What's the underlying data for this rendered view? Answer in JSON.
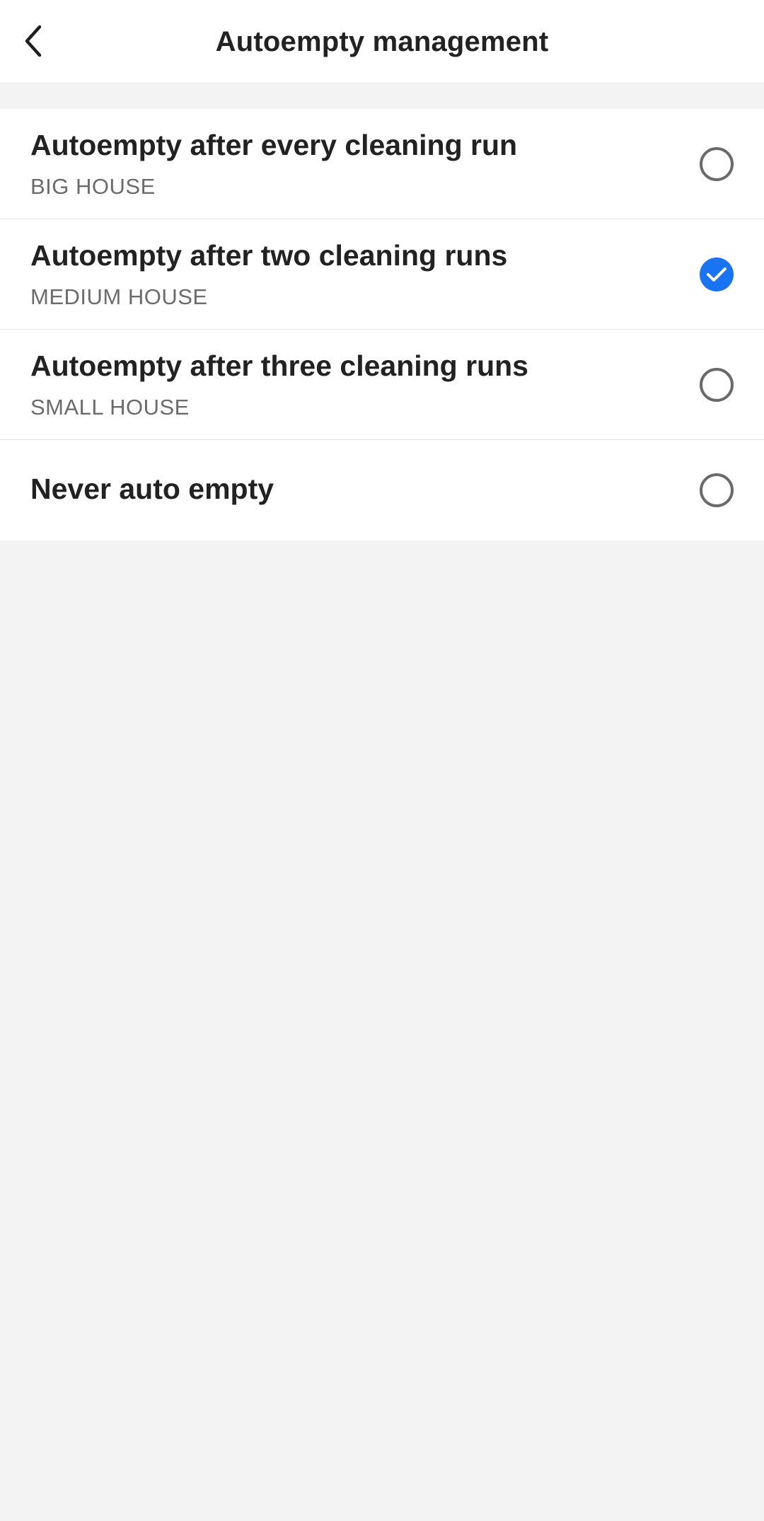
{
  "header": {
    "title": "Autoempty management",
    "back_icon": "chevron-left-icon"
  },
  "options": [
    {
      "title": "Autoempty after every cleaning run",
      "subtitle": "BIG HOUSE",
      "selected": false
    },
    {
      "title": "Autoempty after two cleaning runs",
      "subtitle": "MEDIUM HOUSE",
      "selected": true
    },
    {
      "title": "Autoempty after three cleaning runs",
      "subtitle": "SMALL HOUSE",
      "selected": false
    },
    {
      "title": "Never auto empty",
      "subtitle": "",
      "selected": false
    }
  ],
  "colors": {
    "accent": "#1a73f0",
    "background": "#f3f3f3",
    "surface": "#ffffff"
  }
}
